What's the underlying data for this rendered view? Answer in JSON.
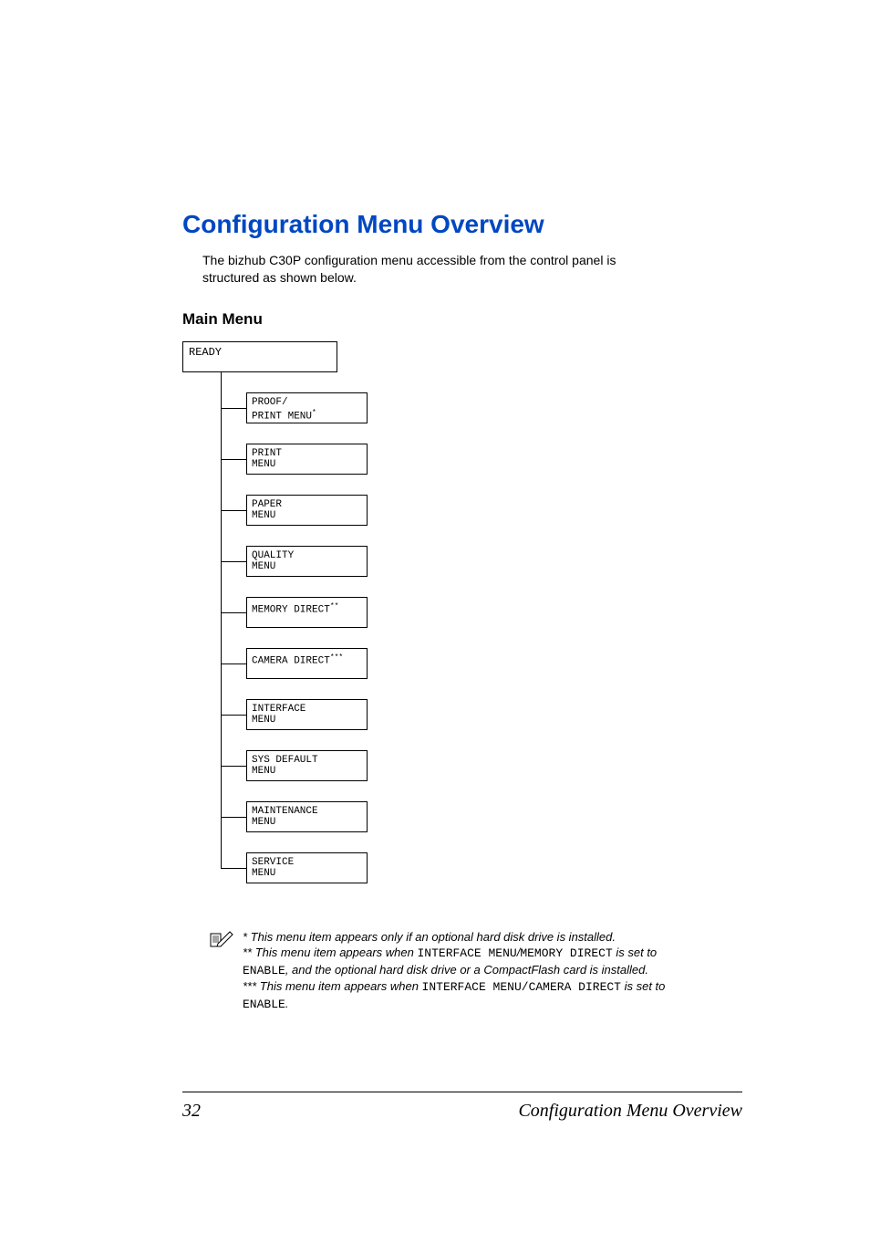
{
  "heading": "Configuration Menu Overview",
  "intro": "The bizhub C30P configuration menu accessible from the control panel is structured as shown below.",
  "section": "Main Menu",
  "tree": {
    "root": "READY",
    "items": [
      {
        "line1": "PROOF/",
        "line2": "PRINT MENU",
        "marks": "*"
      },
      {
        "line1": "PRINT",
        "line2": "MENU",
        "marks": ""
      },
      {
        "line1": "PAPER",
        "line2": "MENU",
        "marks": ""
      },
      {
        "line1": "QUALITY",
        "line2": "MENU",
        "marks": ""
      },
      {
        "line1": "MEMORY DIRECT",
        "line2": "",
        "marks": "**"
      },
      {
        "line1": "CAMERA DIRECT",
        "line2": "",
        "marks": "***"
      },
      {
        "line1": "INTERFACE",
        "line2": "MENU",
        "marks": ""
      },
      {
        "line1": "SYS DEFAULT",
        "line2": "MENU",
        "marks": ""
      },
      {
        "line1": "MAINTENANCE",
        "line2": "MENU",
        "marks": ""
      },
      {
        "line1": "SERVICE",
        "line2": "MENU",
        "marks": ""
      }
    ]
  },
  "notes": {
    "n1a": "* This menu item appears only if an optional hard disk drive is installed.",
    "n2a": "** This menu item appears when ",
    "n2m1": "INTERFACE MENU",
    "n2s": "/",
    "n2m2": "MEMORY DIRECT",
    "n2b": " is set to ",
    "n2m3": "ENABLE",
    "n2c": ", and the optional hard disk drive or a CompactFlash card is installed.",
    "n3a": "*** This menu item appears when ",
    "n3m1": "INTERFACE MENU/CAMERA DIRECT",
    "n3b": " is set to ",
    "n3m2": "ENABLE",
    "n3c": "."
  },
  "footer": {
    "page": "32",
    "title": "Configuration Menu Overview"
  }
}
